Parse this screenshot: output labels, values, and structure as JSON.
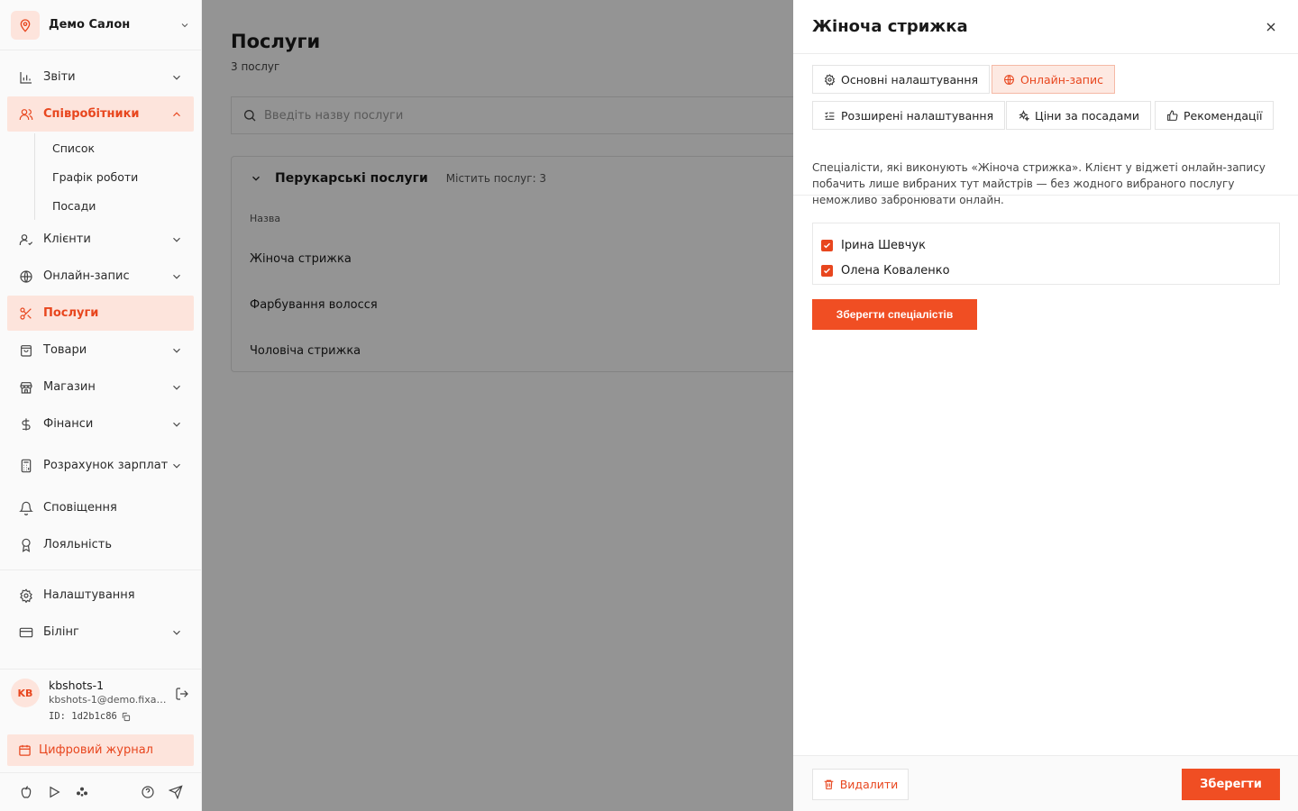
{
  "sidebar": {
    "salon_name": "Демо Салон",
    "items": {
      "reports": "Звіти",
      "staff": "Співробітники",
      "staff_sub": [
        "Список",
        "Графік роботи",
        "Посади"
      ],
      "clients": "Клієнти",
      "online": "Онлайн-запис",
      "services": "Послуги",
      "goods": "Товари",
      "shop": "Магазин",
      "finance": "Фінанси",
      "payroll": "Розрахунок зарплат",
      "notifications": "Сповіщення",
      "loyalty": "Лояльність",
      "settings": "Налаштування",
      "billing": "Білінг"
    },
    "user": {
      "initials": "KB",
      "name": "kbshots-1",
      "email": "kbshots-1@demo.fixa.b...",
      "id": "ID: 1d2b1c86"
    },
    "journal": "Цифровий журнал"
  },
  "main": {
    "title": "Послуги",
    "subtitle": "3 послуг",
    "search_placeholder": "Введіть назву послуги",
    "category": {
      "name": "Перукарські послуги",
      "count": "Містить послуг: 3",
      "column": "Назва",
      "services": [
        "Жіноча стрижка",
        "Фарбування волосся",
        "Чоловіча стрижка"
      ]
    }
  },
  "panel": {
    "title": "Жіноча стрижка",
    "tabs": {
      "basic": "Основні налаштування",
      "online": "Онлайн-запис",
      "advanced": "Розширені налаштування",
      "prices": "Ціни за посадами",
      "recommend": "Рекомендації"
    },
    "description": "Спеціалісти, які виконують «Жіноча стрижка». Клієнт у віджеті онлайн-запису побачить лише вибраних тут майстрів — без жодного вибраного послугу неможливо забронювати онлайн.",
    "specialists": [
      {
        "name": "Ірина Шевчук",
        "checked": true
      },
      {
        "name": "Олена Коваленко",
        "checked": true
      }
    ],
    "save_specialists": "Зберегти спеціалістів",
    "delete": "Видалити",
    "save": "Зберегти"
  },
  "colors": {
    "accent": "#f04e23",
    "accent_light": "#fde4dc"
  }
}
